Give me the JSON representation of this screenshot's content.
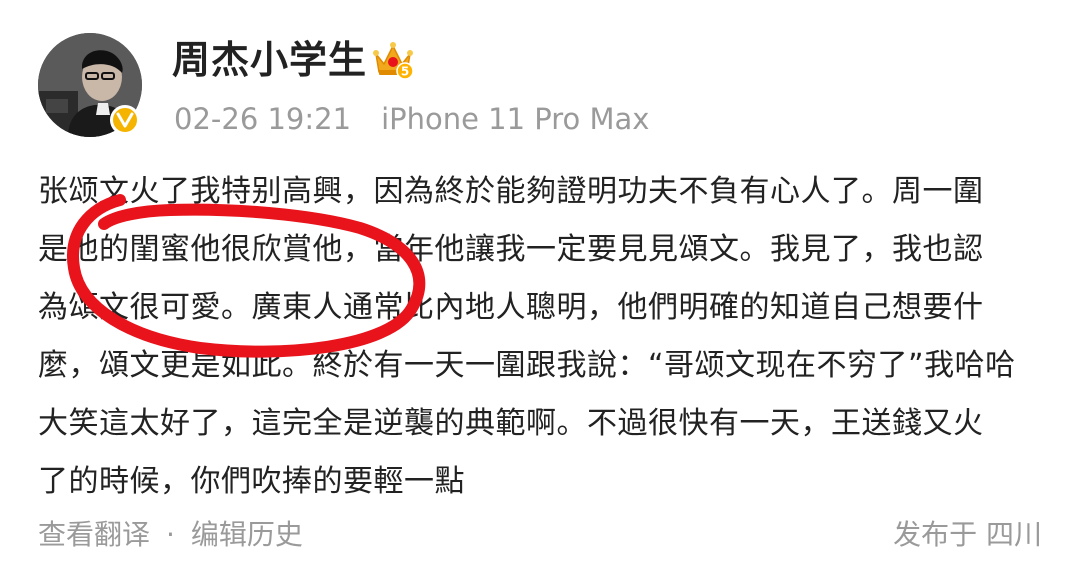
{
  "header": {
    "username": "周杰小学生",
    "timestamp": "02-26 19:21",
    "device": "iPhone 11 Pro Max",
    "level_badge": "5",
    "icons": {
      "avatar": "avatar-image",
      "verified": "verified-v-icon",
      "crown": "vip-crown-icon"
    }
  },
  "post": {
    "lines": [
      "张颂文火了我特别高興，因為終於能夠證明功夫不負有心人了。周一圍",
      "是他的閨蜜他很欣賞他，當年他讓我一定要見見頌文。我見了，我也認",
      "為頌文很可愛。廣東人通常比內地人聰明，他們明確的知道自己想要什",
      "麼，頌文更是如此。終於有一天一圍跟我說：“哥颂文现在不穷了”我哈哈",
      "大笑這太好了，這完全是逆襲的典範啊。不過很快有一天，王送錢又火",
      "了的時候，你們吹捧的要輕一點"
    ]
  },
  "footer": {
    "translate": "查看翻译",
    "separator": "·",
    "edit_history": "编辑历史",
    "location": "发布于 四川"
  },
  "colors": {
    "text": "#222222",
    "meta": "#9a9a9a",
    "ink_circle": "#e8131b",
    "verified": "#f5b400",
    "crown": "#f2a81d"
  }
}
